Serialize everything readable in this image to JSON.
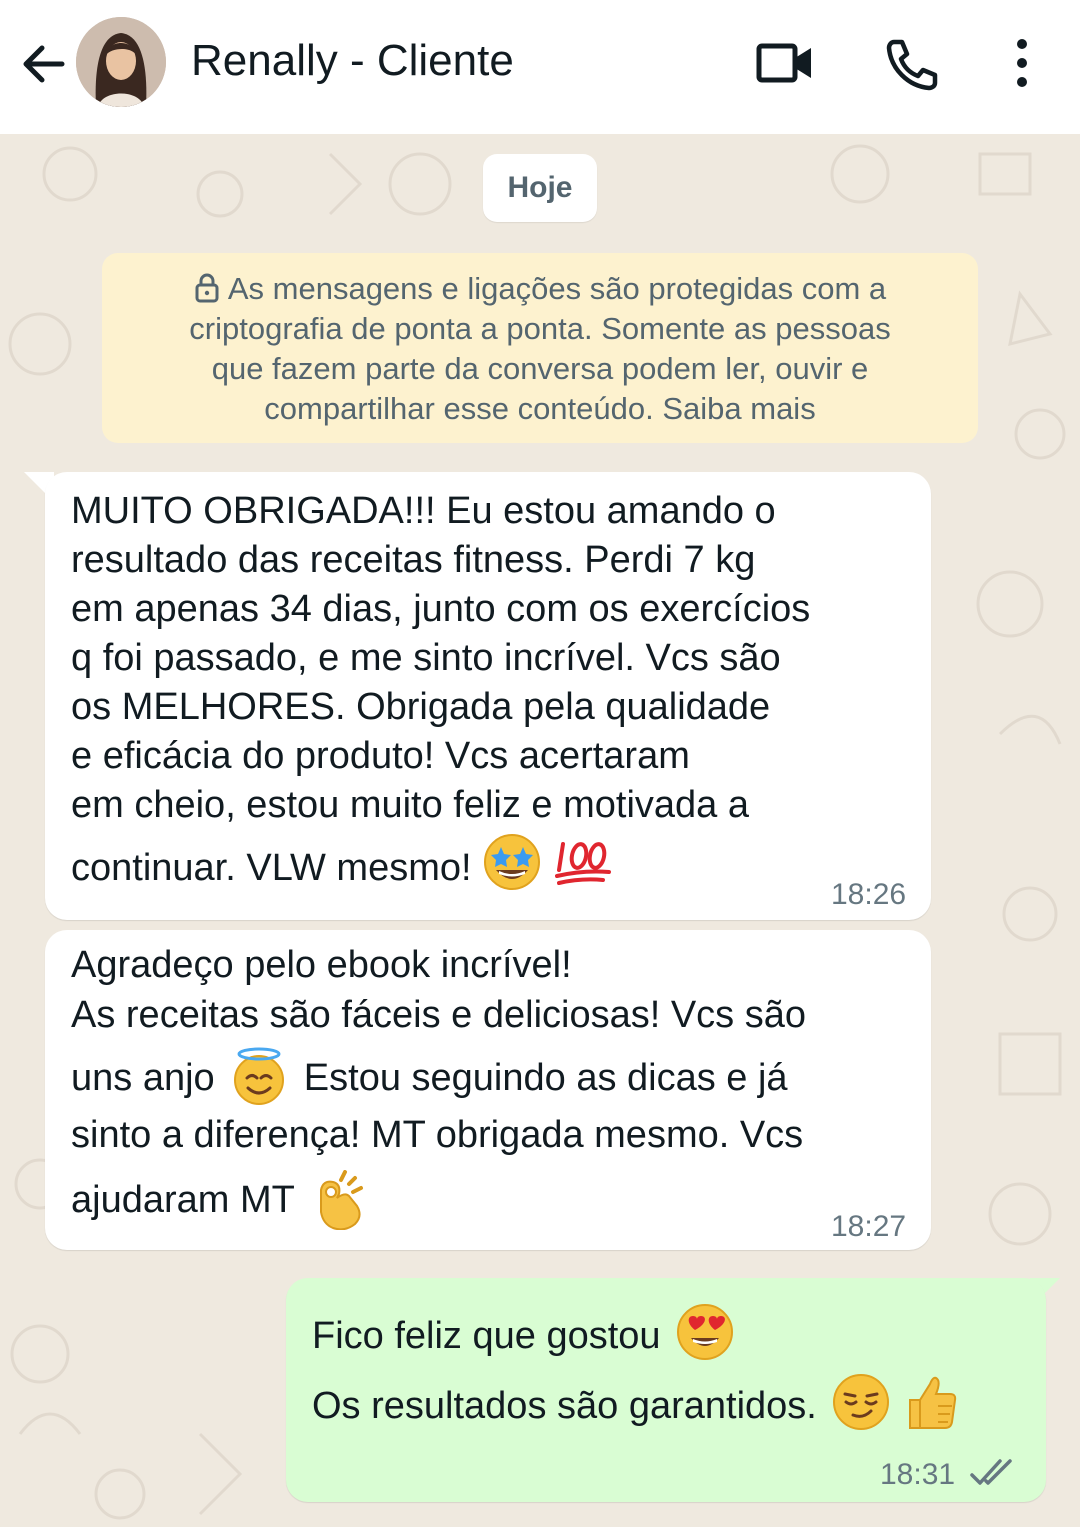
{
  "header": {
    "contact_name": "Renally - Cliente",
    "back_icon": "arrow-left-icon",
    "video_icon": "video-call-icon",
    "call_icon": "phone-icon",
    "menu_icon": "more-vert-icon"
  },
  "chat": {
    "day_label": "Hoje",
    "encryption_notice": {
      "lines": [
        "As mensagens e ligações são protegidas com a",
        "criptografia de ponta a ponta. Somente as pessoas",
        "que fazem parte da conversa podem ler, ouvir e",
        "compartilhar esse conteúdo. Saiba mais"
      ]
    },
    "messages": [
      {
        "direction": "incoming",
        "lines": [
          "MUITO OBRIGADA!!! Eu estou amando o",
          "resultado das receitas fitness. Perdi 7 kg",
          "em apenas 34 dias, junto com os exercícios",
          "q foi passado, e me sinto incrível. Vcs são",
          "os MELHORES. Obrigada pela qualidade",
          "e eficácia do produto! Vcs acertaram",
          "em cheio, estou muito feliz e motivada a",
          "continuar. VLW mesmo!"
        ],
        "emojis": [
          "star-struck-emoji",
          "hundred-points-emoji"
        ],
        "time": "18:26"
      },
      {
        "direction": "incoming",
        "lines": [
          "Agradeço pelo ebook incrível!",
          "As receitas são fáceis e deliciosas! Vcs são",
          "uns anjo",
          "Estou seguindo as dicas e já",
          "sinto a diferença! MT obrigada mesmo. Vcs",
          "ajudaram MT"
        ],
        "emojis": [
          "smiling-face-with-halo-emoji",
          "ok-hand-emoji"
        ],
        "time": "18:27"
      },
      {
        "direction": "outgoing",
        "lines": [
          "Fico feliz que gostou",
          "Os resultados são garantidos."
        ],
        "emojis": [
          "heart-eyes-emoji",
          "smirking-face-emoji",
          "thumbs-up-emoji"
        ],
        "time": "18:31",
        "status": "read",
        "status_icon": "double-check-icon"
      }
    ]
  },
  "colors": {
    "header_bg": "#ffffff",
    "chat_bg": "#efe9df",
    "incoming_bubble": "#ffffff",
    "outgoing_bubble": "#d9fdd3",
    "notice_bg": "#fdf2cf",
    "text": "#111b21",
    "meta_text": "#667781"
  }
}
